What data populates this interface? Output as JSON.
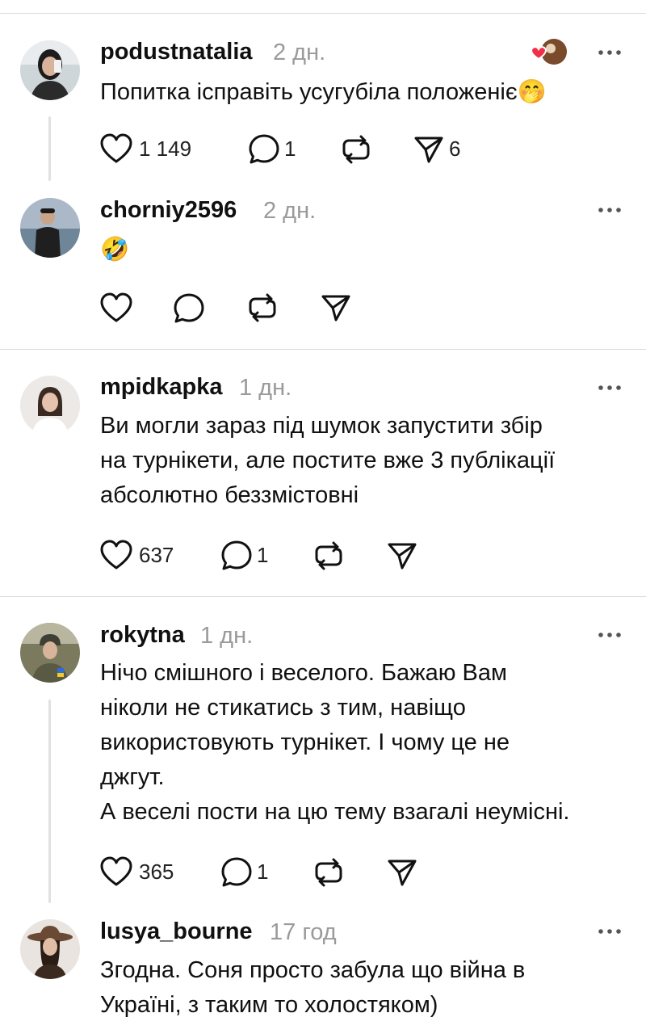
{
  "comments": [
    {
      "username": "podustnatalia",
      "time": "2 дн.",
      "text_lines": [
        "Попитка ісправіть усугубіла положеніє"
      ],
      "text_emoji": "🤭",
      "likes": "1 149",
      "replies": "1",
      "reposts": "",
      "shares": "6"
    },
    {
      "username": "chorniy2596",
      "time": "2 дн.",
      "text_lines": [
        ""
      ],
      "text_emoji": "🤣",
      "likes": "",
      "replies": "",
      "reposts": "",
      "shares": ""
    },
    {
      "username": "mpidkapka",
      "time": "1 дн.",
      "text_lines": [
        "Ви могли зараз під шумок запустити збір",
        "на турнікети, але постите вже 3 публікації",
        "абсолютно беззмістовні"
      ],
      "likes": "637",
      "replies": "1",
      "reposts": "",
      "shares": ""
    },
    {
      "username": "rokytna",
      "time": "1 дн.",
      "text_lines": [
        "Нічо смішного і веселого. Бажаю Вам",
        "ніколи не стикатись з тим, навіщо",
        "використовують турнікет. І чому це не",
        "джгут.",
        "А веселі пости на цю тему взагалі неумісні."
      ],
      "likes": "365",
      "replies": "1",
      "reposts": "",
      "shares": ""
    },
    {
      "username": "lusya_bourne",
      "time": "17 год",
      "text_lines": [
        "Згодна. Соня просто забула що війна в",
        "Україні, з таким то холостяком)"
      ]
    }
  ],
  "icons": {
    "like": "heart-icon",
    "reply": "speech-bubble-icon",
    "repost": "repost-arrows-icon",
    "share": "send-arrow-icon",
    "more": "more-dots-icon"
  },
  "colors": {
    "text": "#101010",
    "muted": "#9a9a9a",
    "divider": "#dcdcdc",
    "thread": "#e1e1e1",
    "heart_red": "#f0304a"
  }
}
